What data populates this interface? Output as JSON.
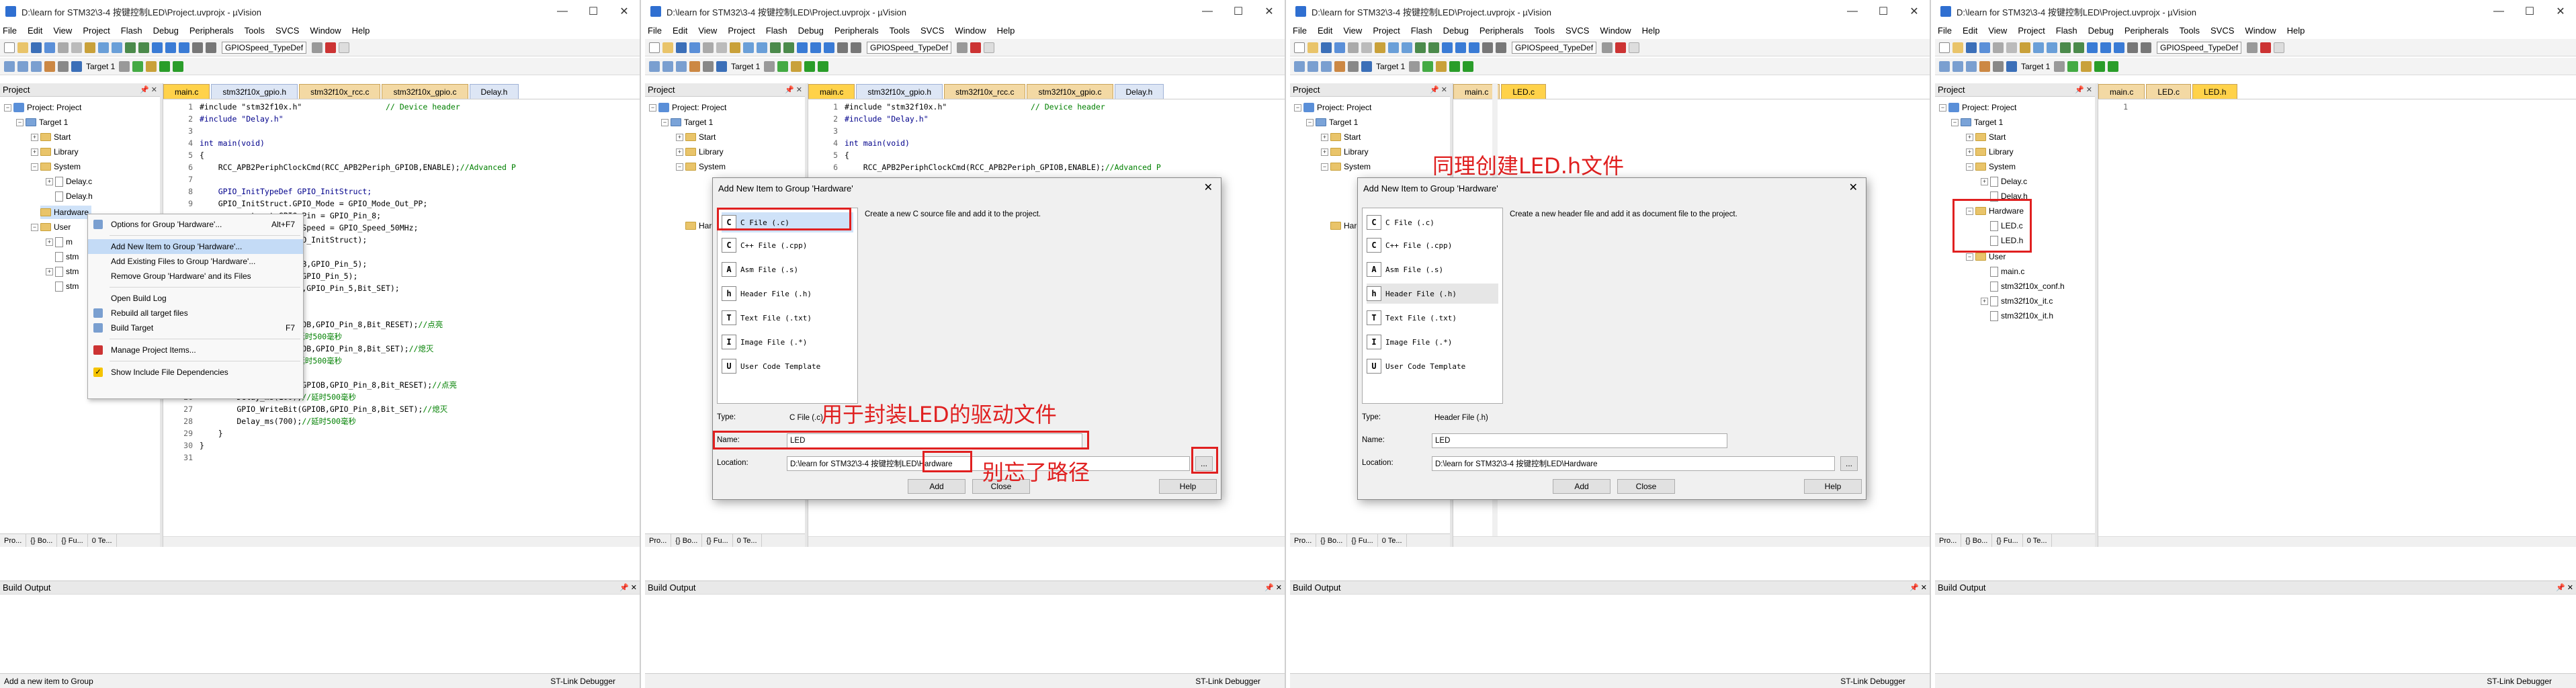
{
  "common": {
    "title": "D:\\learn for STM32\\3-4 按键控制LED\\Project.uvprojx - µVision",
    "menus": [
      "File",
      "Edit",
      "View",
      "Project",
      "Flash",
      "Debug",
      "Peripherals",
      "Tools",
      "SVCS",
      "Window",
      "Help"
    ],
    "toolbar_select": "GPIOSpeed_TypeDef",
    "target_label": "Target 1",
    "project_header": "Project",
    "build_output": "Build Output",
    "status_right": "ST-Link Debugger",
    "bottom_tabs": [
      "Pro...",
      "{} Bo...",
      "{} Fu...",
      "0 Te..."
    ]
  },
  "panel1": {
    "tree": [
      "Project: Project",
      "Target 1",
      "Start",
      "Library",
      "System",
      "Delay.c",
      "Delay.h",
      "Hardware",
      "User"
    ],
    "tree_partial": [
      "m",
      "stm",
      "stm",
      "stm"
    ],
    "tabs": [
      "main.c",
      "stm32f10x_gpio.h",
      "stm32f10x_rcc.c",
      "stm32f10x_gpio.c",
      "Delay.h"
    ],
    "code": [
      {
        "n": "1",
        "t": "#include \"stm32f10x.h\"                  // Device header"
      },
      {
        "n": "2",
        "t": "#include \"Delay.h\""
      },
      {
        "n": "3",
        "t": ""
      },
      {
        "n": "4",
        "t": "int main(void)"
      },
      {
        "n": "5",
        "t": "{"
      },
      {
        "n": "6",
        "t": "    RCC_APB2PeriphClockCmd(RCC_APB2Periph_GPIOB,ENABLE);//Advanced P"
      },
      {
        "n": "7",
        "t": ""
      },
      {
        "n": "8",
        "t": "    GPIO_InitTypeDef GPIO_InitStruct;"
      },
      {
        "n": "9",
        "t": "    GPIO_InitStruct.GPIO_Mode = GPIO_Mode_Out_PP;"
      },
      {
        "n": "",
        "t": "           truct.GPIO_Pin = GPIO_Pin_8;"
      },
      {
        "n": "",
        "t": "           truct.GPIO_Speed = GPIO_Speed_50MHz;"
      },
      {
        "n": "",
        "t": "           GPIOB, &GPIO_InitStruct);"
      },
      {
        "n": "",
        "t": ""
      },
      {
        "n": "",
        "t": "           etBits(GPIOB,GPIO_Pin_5);"
      },
      {
        "n": "",
        "t": "           Bits(GPIOB,GPIO_Pin_5);"
      },
      {
        "n": "",
        "t": "           teBit(GPIOB,GPIO_Pin_5,Bit_SET);"
      },
      {
        "n": "",
        "t": ""
      },
      {
        "n": "",
        "t": ""
      },
      {
        "n": "",
        "t": "           riteBit(GPIOB,GPIO_Pin_8,Bit_RESET);//点亮"
      },
      {
        "n": "",
        "t": "           ms(100);//延时500毫秒"
      },
      {
        "n": "",
        "t": "           riteBit(GPIOB,GPIO_Pin_8,Bit_SET);//熄灭"
      },
      {
        "n": "",
        "t": "           ms(100);//延时500毫秒"
      },
      {
        "n": "",
        "t": ""
      },
      {
        "n": "25",
        "t": "        GPIO_WriteBit(GPIOB,GPIO_Pin_8,Bit_RESET);//点亮"
      },
      {
        "n": "26",
        "t": "        Delay_ms(100);//延时500毫秒"
      },
      {
        "n": "27",
        "t": "        GPIO_WriteBit(GPIOB,GPIO_Pin_8,Bit_SET);//熄灭"
      },
      {
        "n": "28",
        "t": "        Delay_ms(700);//延时500毫秒"
      },
      {
        "n": "29",
        "t": "    }"
      },
      {
        "n": "30",
        "t": "}"
      },
      {
        "n": "31",
        "t": ""
      }
    ],
    "context_menu": {
      "items": [
        {
          "label": "Options for Group 'Hardware'...",
          "shortcut": "Alt+F7"
        },
        {
          "label": "Add New  Item to Group 'Hardware'...",
          "shortcut": ""
        },
        {
          "label": "Add Existing Files to Group 'Hardware'...",
          "shortcut": ""
        },
        {
          "label": "Remove Group 'Hardware' and its Files",
          "shortcut": ""
        },
        {
          "label": "Open Build Log",
          "shortcut": ""
        },
        {
          "label": "Rebuild all target files",
          "shortcut": ""
        },
        {
          "label": "Build Target",
          "shortcut": "F7"
        },
        {
          "label": "Manage Project Items...",
          "shortcut": ""
        },
        {
          "label": "Show Include File Dependencies",
          "shortcut": ""
        }
      ]
    },
    "status_left": "Add a new item to Group"
  },
  "dialog": {
    "title": "Add New Item to Group 'Hardware'",
    "types": [
      "C File (.c)",
      "C++ File (.cpp)",
      "Asm File (.s)",
      "Header File (.h)",
      "Text File (.txt)",
      "Image File (.*)",
      "User Code Template"
    ],
    "type_icons": [
      "C",
      "C",
      "A",
      "h",
      "T",
      "I",
      "U"
    ],
    "type_label": "Type:",
    "name_label": "Name:",
    "location_label": "Location:",
    "add": "Add",
    "close": "Close",
    "help": "Help",
    "browse": "...",
    "close_x": "✕"
  },
  "panel2": {
    "tree": [
      "Project: Project",
      "Target 1",
      "Start",
      "Library",
      "System",
      "Hardware"
    ],
    "tabs": [
      "main.c",
      "stm32f10x_gpio.h",
      "stm32f10x_rcc.c",
      "stm32f10x_gpio.c",
      "Delay.h"
    ],
    "code": [
      {
        "n": "1",
        "t": "#include \"stm32f10x.h\"                  // Device header"
      },
      {
        "n": "2",
        "t": "#include \"Delay.h\""
      },
      {
        "n": "3",
        "t": ""
      },
      {
        "n": "4",
        "t": "int main(void)"
      },
      {
        "n": "5",
        "t": "{"
      },
      {
        "n": "6",
        "t": "    RCC_APB2PeriphClockCmd(RCC_APB2Periph_GPIOB,ENABLE);//Advanced P"
      }
    ],
    "desc": "Create a new C source file and add it to the project.",
    "type_value": "C File (.c)",
    "name_value": "LED",
    "location_value": "D:\\learn for STM32\\3-4 按键控制LED\\Hardware",
    "annot1": "用于封装LED的驱动文件",
    "annot2": "别忘了路径"
  },
  "panel3": {
    "tree": [
      "Project: Project",
      "Target 1",
      "Start",
      "Library",
      "System",
      "Hardware"
    ],
    "tabs": [
      "main.c",
      "LED.c"
    ],
    "desc": "Create a new header file and add it as document file to the project.",
    "type_value": "Header File (.h)",
    "name_value": "LED",
    "location_value": "D:\\learn for STM32\\3-4 按键控制LED\\Hardware",
    "annot": "同理创建LED.h文件"
  },
  "panel4": {
    "tree": [
      "Project: Project",
      "Target 1",
      "Start",
      "Library",
      "System",
      "Delay.c",
      "Delay.h",
      "Hardware",
      "LED.c",
      "LED.h",
      "User",
      "main.c",
      "stm32f10x_conf.h",
      "stm32f10x_it.c",
      "stm32f10x_it.h"
    ],
    "tabs": [
      "main.c",
      "LED.c",
      "LED.h"
    ],
    "code": [
      {
        "n": "1",
        "t": ""
      }
    ]
  },
  "colors": {
    "annotation": "#e02020",
    "tab_active": "#ffd24a",
    "menu_highlight": "#c4dbf6"
  }
}
